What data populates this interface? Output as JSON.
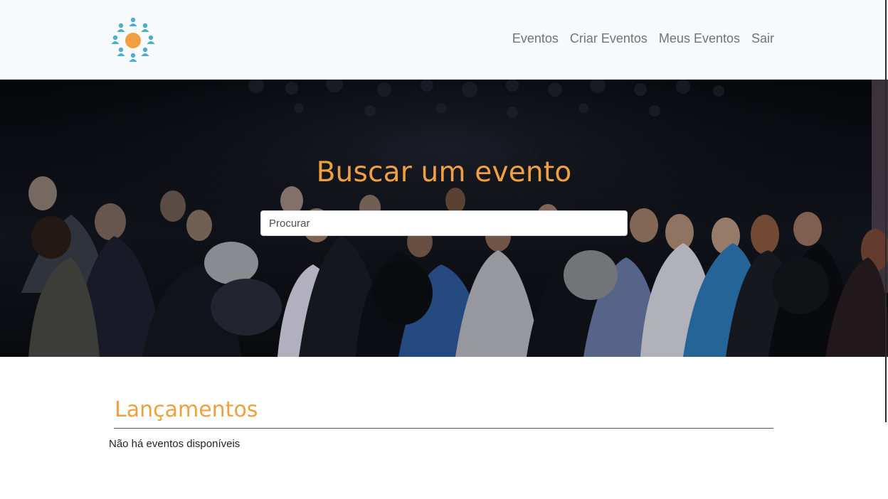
{
  "nav": {
    "items": [
      {
        "label": "Eventos"
      },
      {
        "label": "Criar Eventos"
      },
      {
        "label": "Meus Eventos"
      },
      {
        "label": "Sair"
      }
    ]
  },
  "hero": {
    "title": "Buscar um evento",
    "search_placeholder": "Procurar"
  },
  "releases": {
    "title": "Lançamentos",
    "empty_message": "Não há eventos disponíveis"
  },
  "colors": {
    "accent": "#f0a040",
    "logo_people": "#4aaed0",
    "logo_center": "#f0a040",
    "navbar_bg": "#f8f9fa"
  }
}
